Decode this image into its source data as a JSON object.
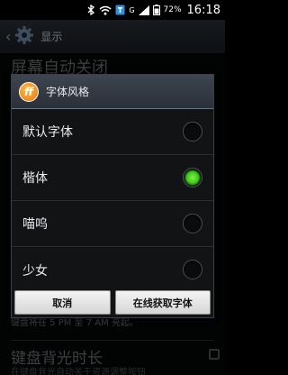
{
  "status_bar": {
    "battery_percent": "72%",
    "time": "16:18",
    "icons": [
      "bluetooth-icon",
      "wifi-icon",
      "app-notification-icon",
      "g-signal-icon",
      "signal-icon",
      "battery-icon"
    ]
  },
  "action_bar": {
    "title": "显示"
  },
  "background_settings": {
    "item1_title": "屏幕自动关闭",
    "item2_summary": "键盘将在 5 PM 至 7 AM 亮起。",
    "item3_title": "键盘背光时长",
    "item4_summary": "在键盘背光自动关于资源调整按钮"
  },
  "dialog": {
    "title": "字体风格",
    "icon_letter": "ff",
    "options": [
      {
        "label": "默认字体",
        "selected": false
      },
      {
        "label": "楷体",
        "selected": true
      },
      {
        "label": "喵呜",
        "selected": false
      },
      {
        "label": "少女",
        "selected": false
      }
    ],
    "cancel_label": "取消",
    "get_fonts_label": "在线获取字体"
  },
  "colors": {
    "selected_radio": "#3fc81a",
    "header_bg": "#2a3038"
  }
}
